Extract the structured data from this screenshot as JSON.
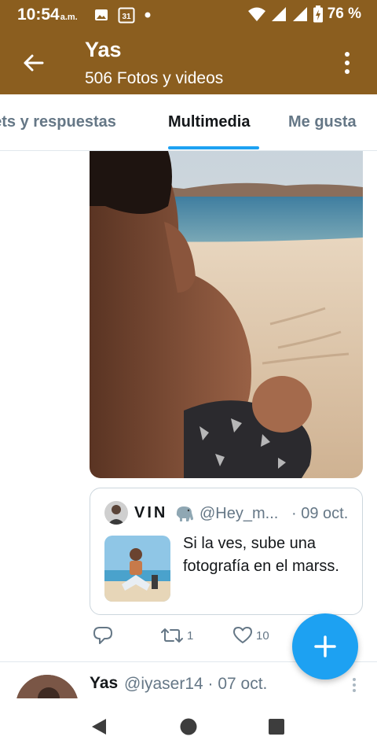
{
  "status_bar": {
    "time": "10:54",
    "ampm": "a.m.",
    "calendar_day": "31",
    "battery": "76 %",
    "icons": [
      "image-icon",
      "calendar-icon",
      "dot-icon",
      "wifi-icon",
      "signal-icon",
      "signal-icon",
      "battery-charging-icon"
    ]
  },
  "header": {
    "title": "Yas",
    "subtitle": "506 Fotos y videos",
    "back_icon": "arrow-left-icon",
    "more_icon": "more-vertical-icon"
  },
  "tabs": [
    {
      "label": "eets y respuestas",
      "active": false
    },
    {
      "label": "Multimedia",
      "active": true
    },
    {
      "label": "Me gusta",
      "active": false
    }
  ],
  "tweet": {
    "photo_icon": "beach-photo",
    "quote": {
      "name": "VIN",
      "emoji": "elephant-emoji",
      "handle": "@Hey_m...",
      "date": "· 09 oct.",
      "text": "Si la ves, sube una fotografía en el marss."
    },
    "actions": {
      "reply_count": "",
      "retweet_count": "1",
      "like_count": "10"
    }
  },
  "next_tweet": {
    "name": "Yas",
    "handle_date": "@iyaser14 · 07 oct."
  },
  "fab_icon": "plus-icon",
  "nav": [
    "back-triangle-icon",
    "home-circle-icon",
    "recents-square-icon"
  ],
  "colors": {
    "header_bg": "#8b5e1f",
    "accent": "#1da1f2",
    "muted_text": "#657786",
    "border": "#e1e8ed"
  }
}
